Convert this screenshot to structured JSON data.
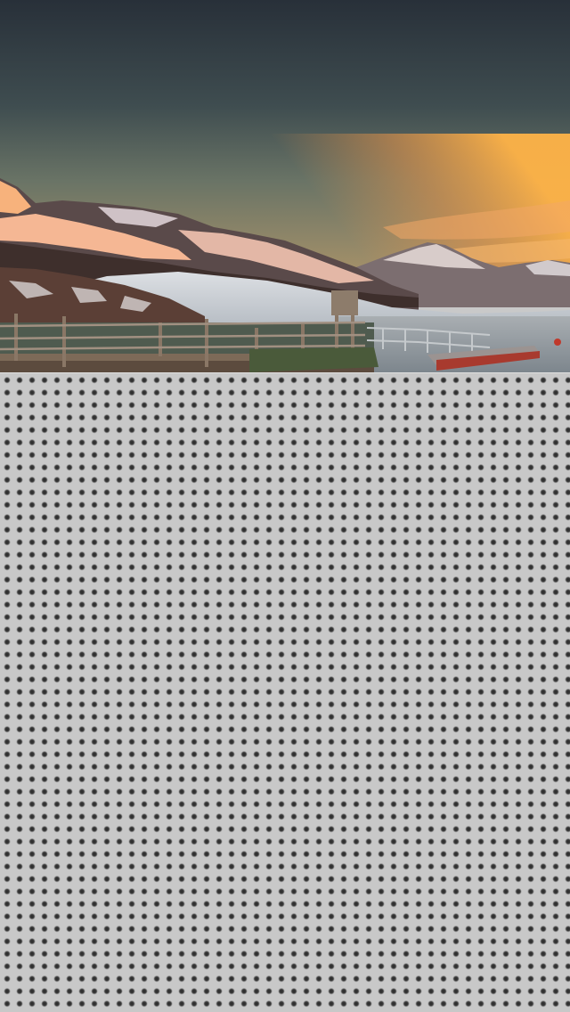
{
  "wallpaper": {
    "scene": "snowy-mountain-lake-sunset",
    "colors": {
      "sky_top": "#2b3540",
      "sky_mid": "#4f5f5e",
      "horizon_glow": "#f0a24a",
      "snow_lit": "#f4b48c",
      "water": "#8f979d",
      "pier_wood": "#6c5a4c"
    }
  },
  "panel": {
    "texture": "perforated-metal",
    "colors": {
      "base": "#c8c8c8",
      "hole": "#2f2f2f"
    }
  }
}
